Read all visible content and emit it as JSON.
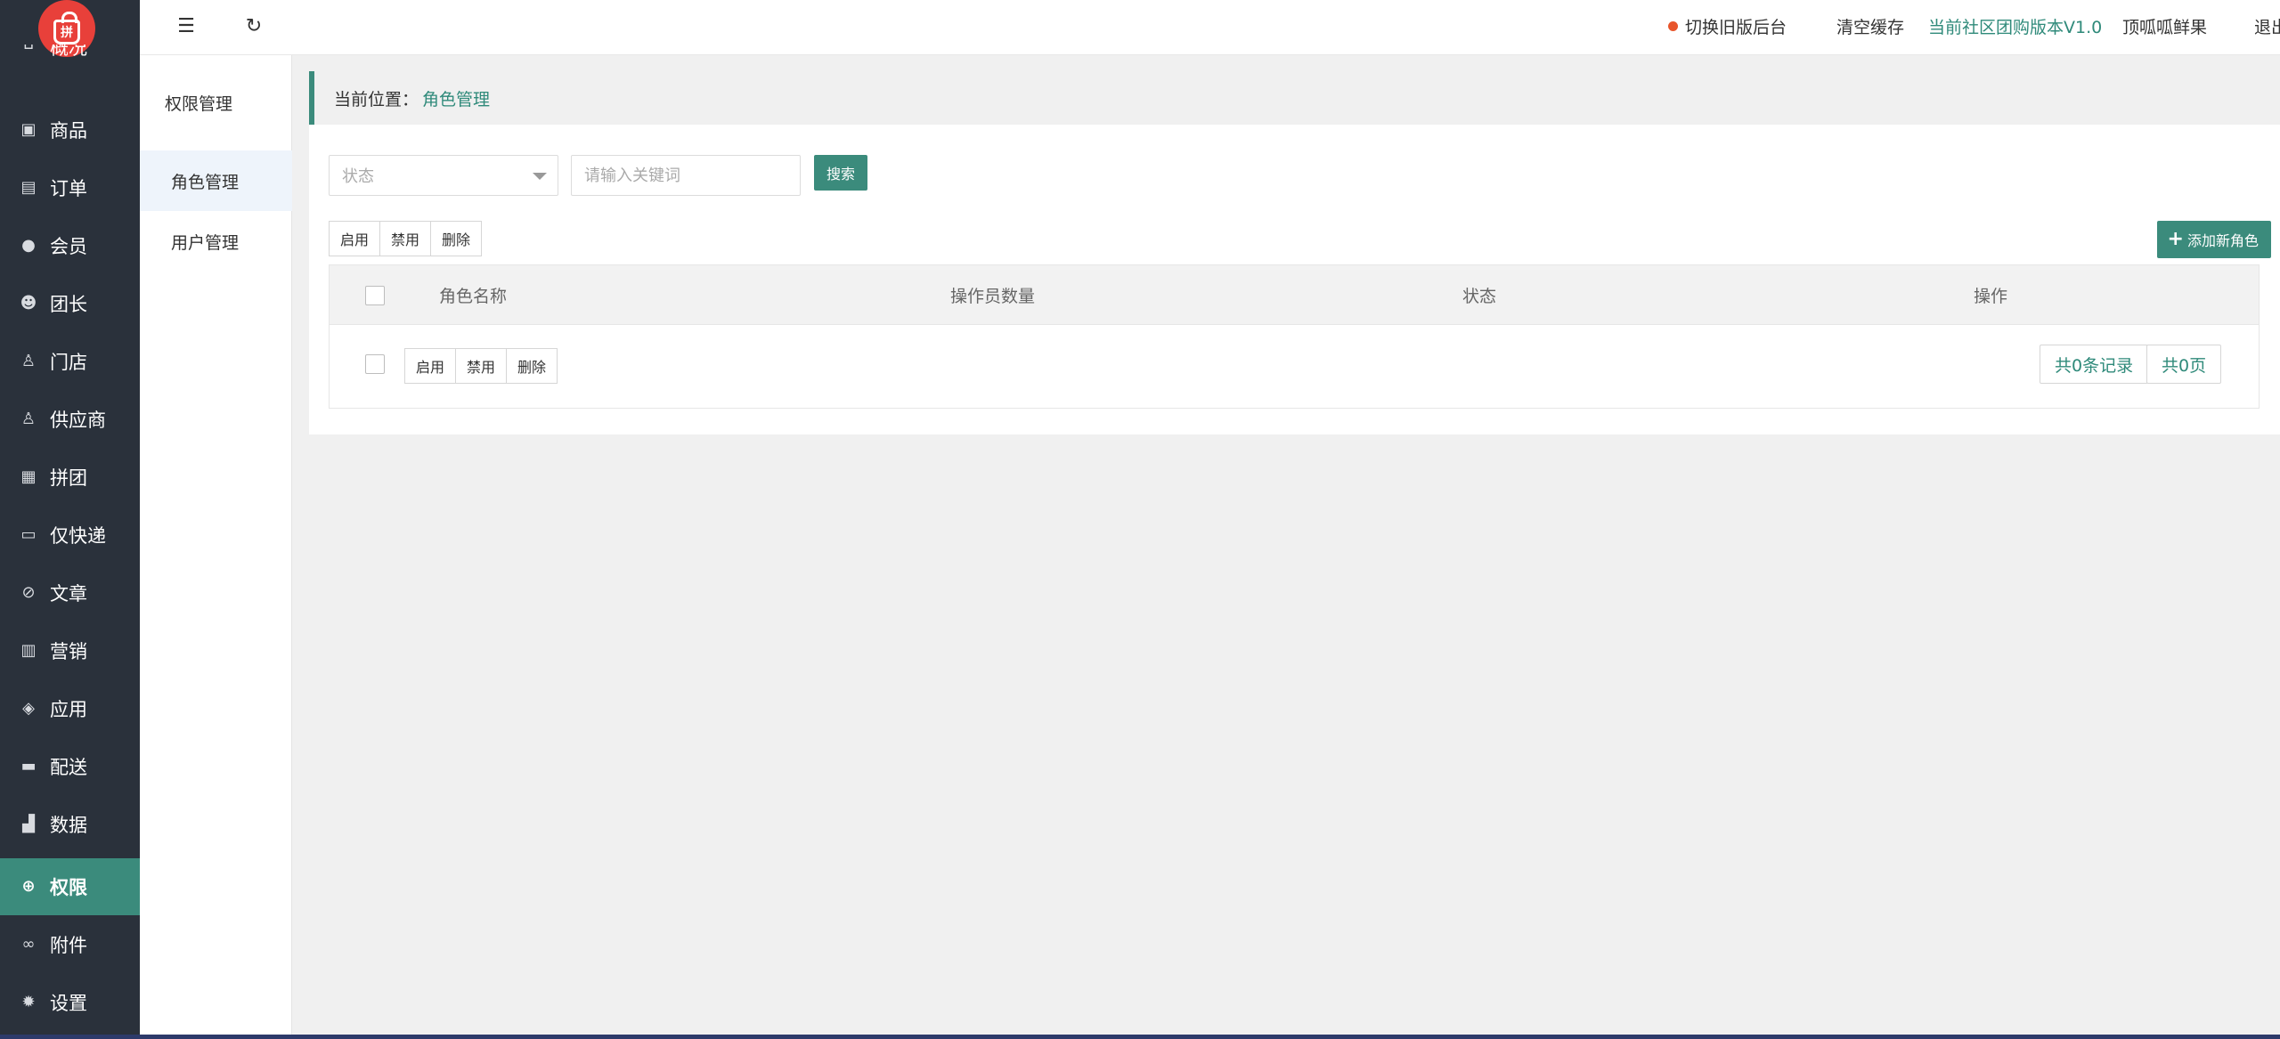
{
  "app": {
    "logo_char": "拼",
    "colors": {
      "sidebar": "#2a313b",
      "accent": "#3b8b7c",
      "logo": "#e8403a",
      "dot": "#e8552b"
    }
  },
  "sidebar": {
    "items": [
      {
        "label": "概况",
        "icon": "home-icon"
      },
      {
        "label": "商品",
        "icon": "product-icon"
      },
      {
        "label": "订单",
        "icon": "order-icon"
      },
      {
        "label": "会员",
        "icon": "member-icon"
      },
      {
        "label": "团长",
        "icon": "leader-icon"
      },
      {
        "label": "门店",
        "icon": "store-icon"
      },
      {
        "label": "供应商",
        "icon": "supplier-icon"
      },
      {
        "label": "拼团",
        "icon": "group-buy-icon"
      },
      {
        "label": "仅快递",
        "icon": "express-icon"
      },
      {
        "label": "文章",
        "icon": "article-icon"
      },
      {
        "label": "营销",
        "icon": "gift-icon"
      },
      {
        "label": "应用",
        "icon": "box-icon"
      },
      {
        "label": "配送",
        "icon": "truck-icon"
      },
      {
        "label": "数据",
        "icon": "chart-icon"
      },
      {
        "label": "权限",
        "icon": "lock-icon",
        "active": true
      },
      {
        "label": "附件",
        "icon": "link-icon"
      },
      {
        "label": "设置",
        "icon": "gear-icon"
      }
    ]
  },
  "subnav": {
    "heading": "权限管理",
    "items": [
      {
        "label": "角色管理",
        "active": true
      },
      {
        "label": "用户管理"
      }
    ]
  },
  "header": {
    "switch_old": "切换旧版后台",
    "clear_cache": "清空缓存",
    "version": "当前社区团购版本V1.0",
    "shop_name": "顶呱呱鲜果",
    "logout": "退出"
  },
  "breadcrumb": {
    "prefix": "当前位置：",
    "current": "角色管理"
  },
  "filters": {
    "status_placeholder": "状态",
    "keyword_placeholder": "请输入关键词",
    "search_label": "搜索"
  },
  "actions": {
    "enable": "启用",
    "disable": "禁用",
    "delete": "删除",
    "add_role": "添加新角色"
  },
  "table": {
    "columns": [
      "角色名称",
      "操作员数量",
      "状态",
      "操作"
    ],
    "rows": []
  },
  "pagination": {
    "total_records": "共0条记录",
    "total_pages": "共0页"
  }
}
